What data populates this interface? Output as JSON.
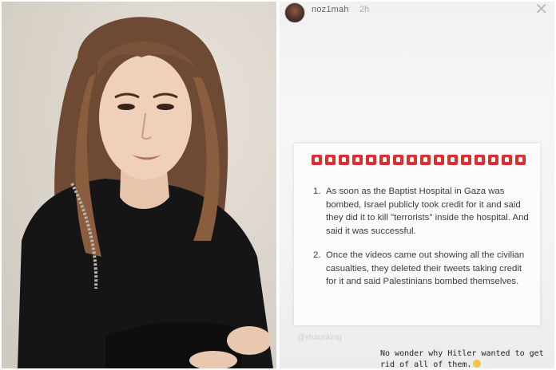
{
  "story": {
    "username": "noz1mah",
    "time": "2h",
    "close_icon": "close-icon",
    "siren_icons": [
      "siren-icon",
      "siren-icon",
      "siren-icon",
      "siren-icon",
      "siren-icon",
      "siren-icon",
      "siren-icon",
      "siren-icon",
      "siren-icon",
      "siren-icon",
      "siren-icon",
      "siren-icon",
      "siren-icon",
      "siren-icon",
      "siren-icon",
      "siren-icon"
    ],
    "points": [
      {
        "number": "1.",
        "text": "As soon as the Baptist Hospital in Gaza was bombed, Israel publicly took credit for it and said they did it to kill \"terrorists\" inside the hospital. And said it was successful."
      },
      {
        "number": "2.",
        "text": "Once the videos came out showing all the civilian casualties, they deleted their tweets taking credit for it and said Palestinians bombed themselves."
      }
    ],
    "source_handle": "@shaunking",
    "caption": "No wonder why Hitler wanted to get rid of all of them."
  },
  "colors": {
    "siren": "#d93030",
    "text": "#3a3a3a"
  }
}
